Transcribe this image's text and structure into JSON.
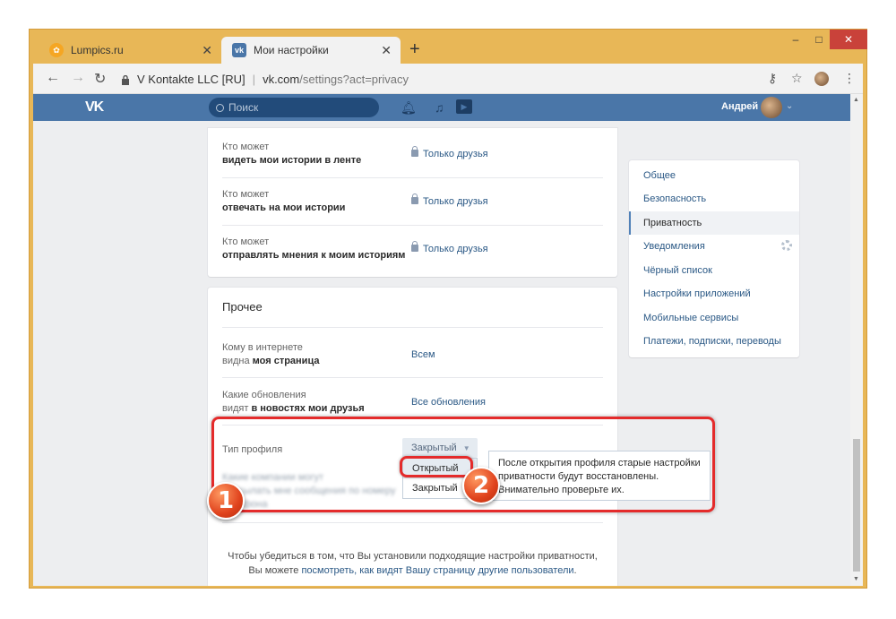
{
  "browser": {
    "tabs": [
      {
        "title": "Lumpics.ru",
        "active": false
      },
      {
        "title": "Мои настройки",
        "active": true
      }
    ],
    "site_identity": "V Kontakte LLC [RU]",
    "url_host": "vk.com",
    "url_path": "/settings?act=privacy"
  },
  "vk_header": {
    "logo": "VK",
    "search_placeholder": "Поиск",
    "user_name": "Андрей"
  },
  "stories_privacy": [
    {
      "line1": "Кто может",
      "line2": "видеть мои истории в ленте",
      "value": "Только друзья"
    },
    {
      "line1": "Кто может",
      "line2": "отвечать на мои истории",
      "value": "Только друзья"
    },
    {
      "line1": "Кто может",
      "line2": "отправлять мнения к моим историям",
      "value": "Только друзья"
    }
  ],
  "other": {
    "title": "Прочее",
    "rows": [
      {
        "line1": "Кому в интернете",
        "line2_plain": "видна ",
        "line2_bold": "моя страница",
        "value": "Всем"
      },
      {
        "line1": "Какие обновления",
        "line2_plain": "видят ",
        "line2_bold": "в новостях мои друзья",
        "value": "Все обновления"
      }
    ],
    "profile_type_label": "Тип профиля",
    "profile_type_value": "Закрытый",
    "profile_type_options": [
      "Открытый",
      "Закрытый"
    ],
    "tooltip": "После открытия профиля старые настройки приватности будут восстановлены. Внимательно проверьте их.",
    "footer_line1": "Чтобы убедиться в том, что Вы установили подходящие настройки приватности,",
    "footer_line2_plain": "Вы можете ",
    "footer_link": "посмотреть, как видят Вашу страницу другие пользователи",
    "footer_end": "."
  },
  "settings_menu": [
    {
      "label": "Общее",
      "selected": false
    },
    {
      "label": "Безопасность",
      "selected": false
    },
    {
      "label": "Приватность",
      "selected": true
    },
    {
      "label": "Уведомления",
      "selected": false
    },
    {
      "label": "Чёрный список",
      "selected": false
    },
    {
      "label": "Настройки приложений",
      "selected": false
    },
    {
      "label": "Мобильные сервисы",
      "selected": false
    },
    {
      "label": "Платежи, подписки, переводы",
      "selected": false
    }
  ],
  "annotations": {
    "badge1": "1",
    "badge2": "2"
  },
  "colors": {
    "vk_blue": "#4a76a8",
    "link": "#2a5885",
    "annotation_red": "#e42b2b",
    "window_frame": "#e8b757"
  }
}
